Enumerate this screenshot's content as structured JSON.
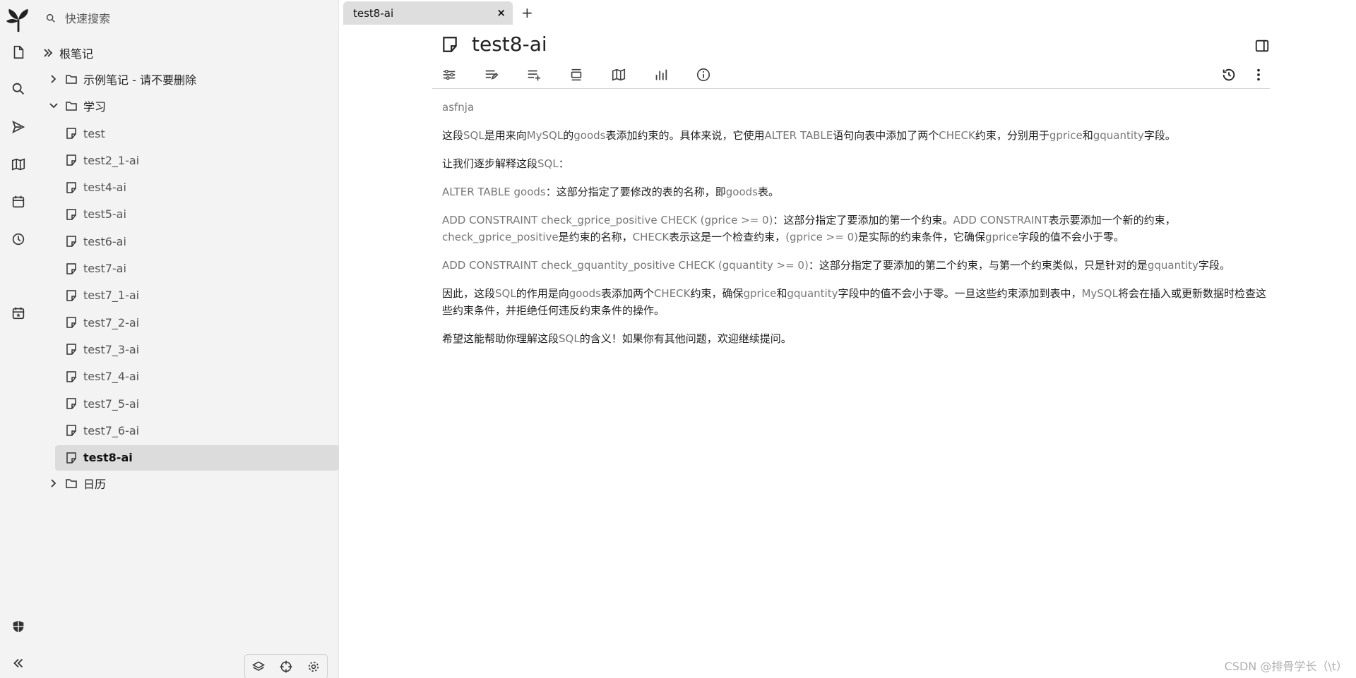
{
  "search": {
    "placeholder": "快速搜索"
  },
  "tree": {
    "root": "根笔记",
    "nodes": [
      {
        "label": "示例笔记 - 请不要删除",
        "type": "folder",
        "expanded": false
      },
      {
        "label": "学习",
        "type": "folder",
        "expanded": true,
        "children": [
          "test",
          "test2_1-ai",
          "test4-ai",
          "test5-ai",
          "test6-ai",
          "test7-ai",
          "test7_1-ai",
          "test7_2-ai",
          "test7_3-ai",
          "test7_4-ai",
          "test7_5-ai",
          "test7_6-ai",
          "test8-ai"
        ],
        "active_child": "test8-ai"
      },
      {
        "label": "日历",
        "type": "folder",
        "expanded": false
      }
    ]
  },
  "tab": {
    "title": "test8-ai",
    "close": "×",
    "new": "+"
  },
  "note": {
    "title": "test8-ai",
    "paragraphs": [
      {
        "runs": [
          {
            "t": "asfnja",
            "g": true
          }
        ]
      },
      {
        "runs": [
          {
            "t": "这段",
            "g": false
          },
          {
            "t": "SQL",
            "g": true
          },
          {
            "t": "是用来向",
            "g": false
          },
          {
            "t": "MySQL",
            "g": true
          },
          {
            "t": "的",
            "g": false
          },
          {
            "t": "goods",
            "g": true
          },
          {
            "t": "表添加约束的。具体来说，它使用",
            "g": false
          },
          {
            "t": "ALTER TABLE",
            "g": true
          },
          {
            "t": "语句向表中添加了两个",
            "g": false
          },
          {
            "t": "CHECK",
            "g": true
          },
          {
            "t": "约束，分别用于",
            "g": false
          },
          {
            "t": "gprice",
            "g": true
          },
          {
            "t": "和",
            "g": false
          },
          {
            "t": "gquantity",
            "g": true
          },
          {
            "t": "字段。",
            "g": false
          }
        ]
      },
      {
        "runs": [
          {
            "t": "让我们逐步解释这段",
            "g": false
          },
          {
            "t": "SQL",
            "g": true
          },
          {
            "t": "：",
            "g": false
          }
        ]
      },
      {
        "runs": [
          {
            "t": "ALTER TABLE goods",
            "g": true
          },
          {
            "t": "：这部分指定了要修改的表的名称，即",
            "g": false
          },
          {
            "t": "goods",
            "g": true
          },
          {
            "t": "表。",
            "g": false
          }
        ]
      },
      {
        "runs": [
          {
            "t": "ADD CONSTRAINT check_gprice_positive CHECK (gprice >= 0)",
            "g": true
          },
          {
            "t": "：这部分指定了要添加的第一个约束。",
            "g": false
          },
          {
            "t": "ADD CONSTRAINT",
            "g": true
          },
          {
            "t": "表示要添加一个新的约束，",
            "g": false
          },
          {
            "t": "check_gprice_positive",
            "g": true
          },
          {
            "t": "是约束的名称，",
            "g": false
          },
          {
            "t": "CHECK",
            "g": true
          },
          {
            "t": "表示这是一个检查约束，",
            "g": false
          },
          {
            "t": "(gprice >= 0)",
            "g": true
          },
          {
            "t": "是实际的约束条件，它确保",
            "g": false
          },
          {
            "t": "gprice",
            "g": true
          },
          {
            "t": "字段的值不会小于零。",
            "g": false
          }
        ]
      },
      {
        "runs": [
          {
            "t": "ADD CONSTRAINT check_gquantity_positive CHECK (gquantity >= 0)",
            "g": true
          },
          {
            "t": "：这部分指定了要添加的第二个约束，与第一个约束类似，只是针对的是",
            "g": false
          },
          {
            "t": "gquantity",
            "g": true
          },
          {
            "t": "字段。",
            "g": false
          }
        ]
      },
      {
        "runs": [
          {
            "t": "因此，这段",
            "g": false
          },
          {
            "t": "SQL",
            "g": true
          },
          {
            "t": "的作用是向",
            "g": false
          },
          {
            "t": "goods",
            "g": true
          },
          {
            "t": "表添加两个",
            "g": false
          },
          {
            "t": "CHECK",
            "g": true
          },
          {
            "t": "约束，确保",
            "g": false
          },
          {
            "t": "gprice",
            "g": true
          },
          {
            "t": "和",
            "g": false
          },
          {
            "t": "gquantity",
            "g": true
          },
          {
            "t": "字段中的值不会小于零。一旦这些约束添加到表中，",
            "g": false
          },
          {
            "t": "MySQL",
            "g": true
          },
          {
            "t": "将会在插入或更新数据时检查这些约束条件，并拒绝任何违反约束条件的操作。",
            "g": false
          }
        ]
      },
      {
        "runs": [
          {
            "t": "希望这能帮助你理解这段",
            "g": false
          },
          {
            "t": "SQL",
            "g": true
          },
          {
            "t": "的含义！如果你有其他问题，欢迎继续提问。",
            "g": false
          }
        ]
      }
    ]
  },
  "watermark": "CSDN @排骨学长（\\t）"
}
